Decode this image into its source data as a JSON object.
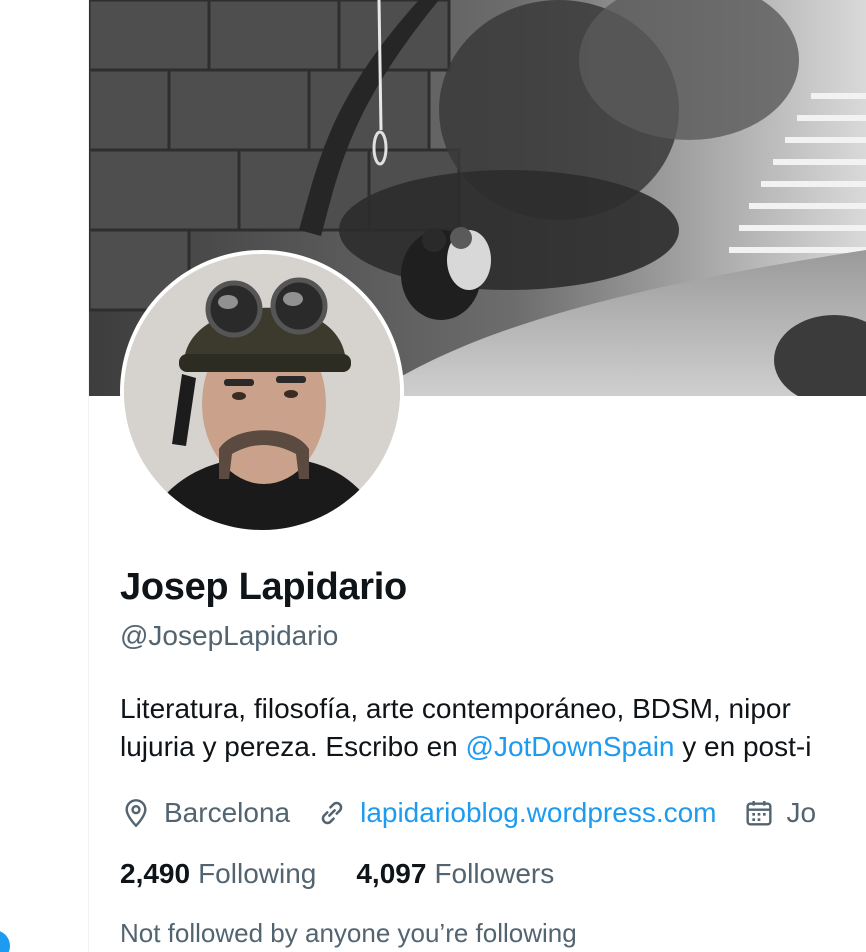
{
  "profile": {
    "display_name": "Josep Lapidario",
    "handle": "@JosepLapidario",
    "bio": {
      "line1": "Literatura, filosofía, arte contemporáneo, BDSM, nipor",
      "line2_before": "lujuria y pereza. Escribo en ",
      "line2_mention": "@JotDownSpain",
      "line2_after": " y en post-i"
    },
    "location": "Barcelona",
    "website": "lapidarioblog.wordpress.com",
    "joined_partial": "Jo",
    "following_count": "2,490",
    "following_label": "Following",
    "followers_count": "4,097",
    "followers_label": "Followers",
    "followed_by_note": "Not followed by anyone you’re following"
  },
  "icons": {
    "location": "map-pin-icon",
    "website": "link-icon",
    "joined": "calendar-icon"
  },
  "colors": {
    "accent": "#1d9bf0",
    "text_primary": "#0f1419",
    "text_secondary": "#536471"
  }
}
